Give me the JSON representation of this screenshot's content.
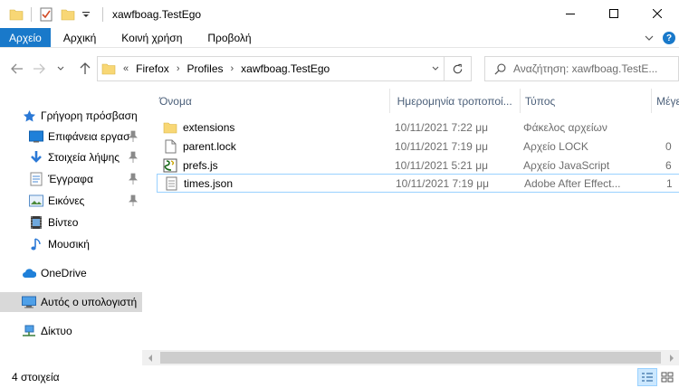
{
  "window": {
    "title": "xawfboag.TestEgo"
  },
  "ribbon": {
    "tabs": [
      "Αρχείο",
      "Αρχική",
      "Κοινή χρήση",
      "Προβολή"
    ]
  },
  "address": {
    "overflow": "«",
    "crumbs": [
      "Firefox",
      "Profiles",
      "xawfboag.TestEgo"
    ]
  },
  "search": {
    "placeholder": "Αναζήτηση: xawfboag.TestE..."
  },
  "nav": {
    "items": [
      {
        "label": "Γρήγορη πρόσβαση",
        "icon": "star-icon",
        "pinned": false
      },
      {
        "label": "Επιφάνεια εργασ",
        "icon": "desktop-icon",
        "pinned": true
      },
      {
        "label": "Στοιχεία λήψης",
        "icon": "download-icon",
        "pinned": true
      },
      {
        "label": "Έγγραφα",
        "icon": "documents-icon",
        "pinned": true
      },
      {
        "label": "Εικόνες",
        "icon": "pictures-icon",
        "pinned": true
      },
      {
        "label": "Βίντεο",
        "icon": "video-icon",
        "pinned": false
      },
      {
        "label": "Μουσική",
        "icon": "music-icon",
        "pinned": false
      },
      {
        "label": "OneDrive",
        "icon": "cloud-icon",
        "pinned": false
      },
      {
        "label": "Αυτός ο υπολογιστή",
        "icon": "computer-icon",
        "pinned": false
      },
      {
        "label": "Δίκτυο",
        "icon": "network-icon",
        "pinned": false
      }
    ]
  },
  "columns": {
    "name": "Όνομα",
    "date": "Ημερομηνία τροποποί...",
    "type": "Τύπος",
    "size": "Μέγεθος"
  },
  "files": [
    {
      "name": "extensions",
      "date": "10/11/2021 7:22 μμ",
      "type": "Φάκελος αρχείων",
      "size": "",
      "icon": "folder-icon"
    },
    {
      "name": "parent.lock",
      "date": "10/11/2021 7:19 μμ",
      "type": "Αρχείο LOCK",
      "size": "0",
      "icon": "file-icon"
    },
    {
      "name": "prefs.js",
      "date": "10/11/2021 5:21 μμ",
      "type": "Αρχείο JavaScript",
      "size": "6",
      "icon": "script-icon"
    },
    {
      "name": "times.json",
      "date": "10/11/2021 7:19 μμ",
      "type": "Adobe After Effect...",
      "size": "1",
      "icon": "json-file-icon"
    }
  ],
  "status": {
    "count": "4 στοιχεία"
  },
  "colors": {
    "accent": "#1979ca",
    "selection_border": "#99d1ff",
    "nav_selected": "#d9d9d9",
    "header_text": "#4c607a",
    "folder": "#f8d775"
  }
}
